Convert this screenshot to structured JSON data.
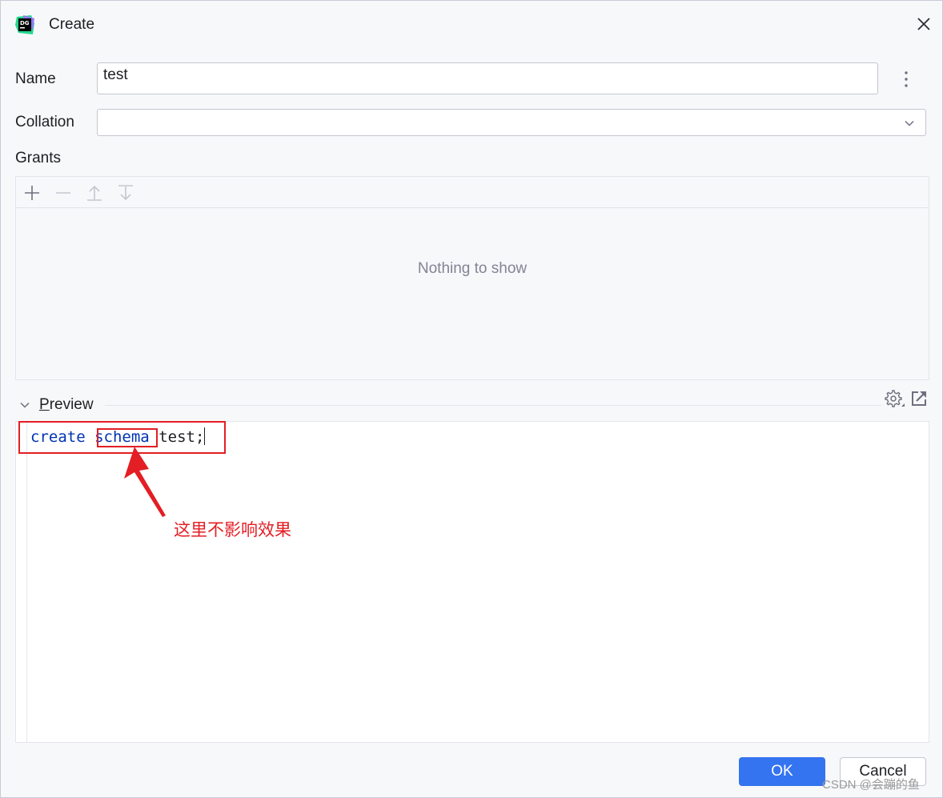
{
  "window": {
    "title": "Create",
    "app_icon": "datagrip-logo-icon"
  },
  "form": {
    "name_label": "Name",
    "name_value": "test",
    "collation_label": "Collation",
    "collation_value": "",
    "grants_label": "Grants"
  },
  "grants": {
    "toolbar": [
      "plus-icon",
      "minus-icon",
      "move-up-icon",
      "move-down-icon"
    ],
    "empty_text": "Nothing to show"
  },
  "preview": {
    "title_underlined": "P",
    "title_rest": "review",
    "code": {
      "kw1": "create",
      "sp1": " ",
      "kw2": "schema",
      "sp2": " ",
      "ident": "test;"
    }
  },
  "annotation": {
    "text": "这里不影响效果"
  },
  "buttons": {
    "ok": "OK",
    "cancel": "Cancel"
  },
  "watermark": "CSDN @会蹦的鱼",
  "colors": {
    "accent": "#3574f0",
    "keyword": "#0033b3",
    "annotation_red": "#e31e24"
  }
}
